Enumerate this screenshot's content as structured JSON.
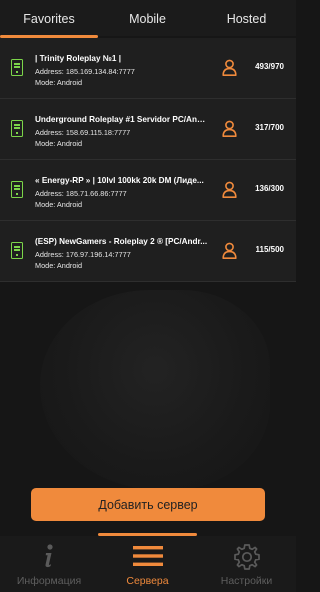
{
  "tabs": [
    {
      "label": "Favorites"
    },
    {
      "label": "Mobile"
    },
    {
      "label": "Hosted"
    }
  ],
  "servers": [
    {
      "name": "|      Trinity Roleplay   №1        |",
      "address": "Address: 185.169.134.84:7777",
      "mode": "Mode: Android",
      "players": "493/970"
    },
    {
      "name": "Underground Roleplay #1 Servidor PC/Andr...",
      "address": "Address: 158.69.115.18:7777",
      "mode": "Mode: Android",
      "players": "317/700"
    },
    {
      "name": "« Energy-RP » | 10lvl 100kk 20k DM (Лиде...",
      "address": "Address: 185.71.66.86:7777",
      "mode": "Mode: Android",
      "players": "136/300"
    },
    {
      "name": "(ESP) NewGamers - Roleplay 2 ® [PC/Andr...",
      "address": "Address: 176.97.196.14:7777",
      "mode": "Mode: Android",
      "players": "115/500"
    }
  ],
  "add_server_label": "Добавить сервер",
  "nav": [
    {
      "label": "Информация",
      "icon": "info-icon"
    },
    {
      "label": "Сервера",
      "icon": "menu-icon"
    },
    {
      "label": "Настройки",
      "icon": "gear-icon"
    }
  ],
  "colors": {
    "accent": "#f08a3c",
    "server_icon": "#7cd64a",
    "background": "#161616"
  }
}
